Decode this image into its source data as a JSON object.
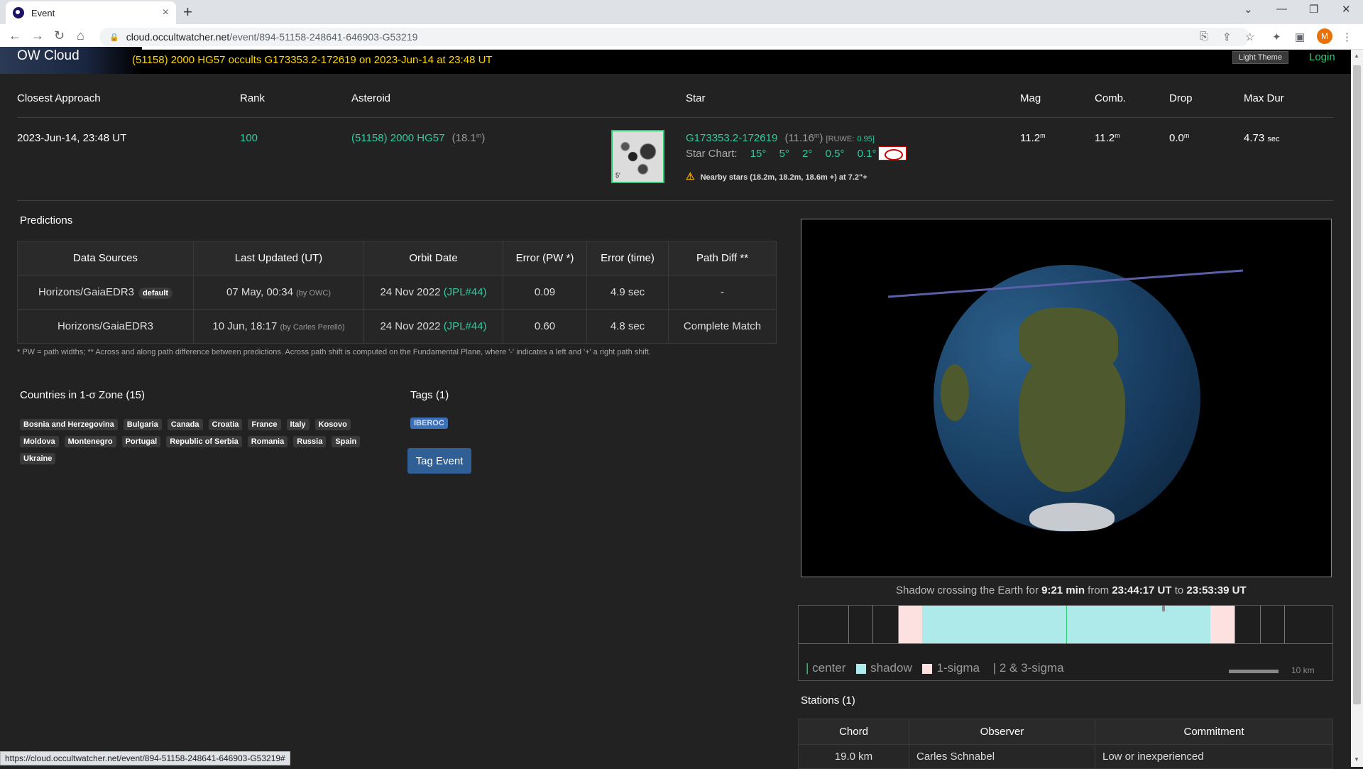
{
  "browser": {
    "tab_title": "Event",
    "url_host": "cloud.occultwatcher.net",
    "url_path": "/event/894-51158-248641-646903-G53219",
    "profile_initial": "M",
    "status_url": "https://cloud.occultwatcher.net/event/894-51158-248641-646903-G53219#"
  },
  "header": {
    "brand": "OW Cloud",
    "headline": "(51158) 2000 HG57 occults G173353.2-172619 on 2023-Jun-14 at 23:48 UT",
    "theme_button": "Light Theme",
    "login": "Login"
  },
  "summary": {
    "headers": {
      "closest": "Closest Approach",
      "rank": "Rank",
      "asteroid": "Asteroid",
      "star": "Star",
      "mag": "Mag",
      "comb": "Comb.",
      "drop": "Drop",
      "maxdur": "Max Dur"
    },
    "closest": "2023-Jun-14, 23:48 UT",
    "rank": "100",
    "asteroid_name": "(51158) 2000 HG57",
    "asteroid_mag": "(18.1",
    "star_name": "G173353.2-172619",
    "star_mag": "(11.16",
    "ruwe_label": "[RUWE:",
    "ruwe_value": "0.95]",
    "thumb_label": "5'",
    "star_chart_label": "Star Chart:",
    "star_chart_scales": [
      "15°",
      "5°",
      "2°",
      "0.5°",
      "0.1°"
    ],
    "nearby": "Nearby stars (18.2m, 18.2m, 18.6m +) at 7.2\"+",
    "mag": "11.2",
    "comb": "11.2",
    "drop": "0.0",
    "maxdur": "4.73",
    "maxdur_unit": "sec",
    "mag_unit": "m"
  },
  "predictions": {
    "title": "Predictions",
    "columns": [
      "Data Sources",
      "Last Updated (UT)",
      "Orbit Date",
      "Error (PW *)",
      "Error (time)",
      "Path Diff **"
    ],
    "rows": [
      {
        "source": "Horizons/GaiaEDR3",
        "badge": "default",
        "updated": "07 May, 00:34",
        "updated_by": "(by OWC)",
        "orbit": "24 Nov 2022",
        "orbit_ref": "(JPL#44)",
        "err_pw": "0.09",
        "err_time": "4.9 sec",
        "path_diff": "-"
      },
      {
        "source": "Horizons/GaiaEDR3",
        "badge": "",
        "updated": "10 Jun, 18:17",
        "updated_by": "(by Carles Perelló)",
        "orbit": "24 Nov 2022",
        "orbit_ref": "(JPL#44)",
        "err_pw": "0.60",
        "err_time": "4.8 sec",
        "path_diff": "Complete Match"
      }
    ],
    "footnote": "* PW = path widths;  ** Across and along path difference between predictions. Across path shift is computed on the Fundamental Plane, where '-' indicates a left and '+' a right path shift."
  },
  "countries": {
    "title": "Countries in 1-σ Zone (15)",
    "items": [
      "Bosnia and Herzegovina",
      "Bulgaria",
      "Canada",
      "Croatia",
      "France",
      "Italy",
      "Kosovo",
      "Moldova",
      "Montenegro",
      "Portugal",
      "Republic of Serbia",
      "Romania",
      "Russia",
      "Spain",
      "Ukraine"
    ]
  },
  "tags": {
    "title": "Tags (1)",
    "items": [
      "IBEROC"
    ],
    "button": "Tag Event"
  },
  "shadow": {
    "prefix": "Shadow crossing the Earth for",
    "duration": "9:21 min",
    "from_label": "from",
    "start": "23:44:17 UT",
    "to_label": "to",
    "end": "23:53:39 UT"
  },
  "profile_legend": {
    "center": "center",
    "shadow": "shadow",
    "sigma1": "1-sigma",
    "sigma23": "2 & 3-sigma",
    "scale": "10 km",
    "colors": {
      "center": "#2ecc71",
      "shadow": "#aeeaea",
      "sigma1": "#fde0e0"
    }
  },
  "stations": {
    "title": "Stations (1)",
    "columns": [
      "Chord",
      "Observer",
      "Commitment"
    ],
    "rows": [
      {
        "chord": "19.0 km",
        "observer": "Carles Schnabel",
        "commitment": "Low or inexperienced"
      }
    ]
  }
}
